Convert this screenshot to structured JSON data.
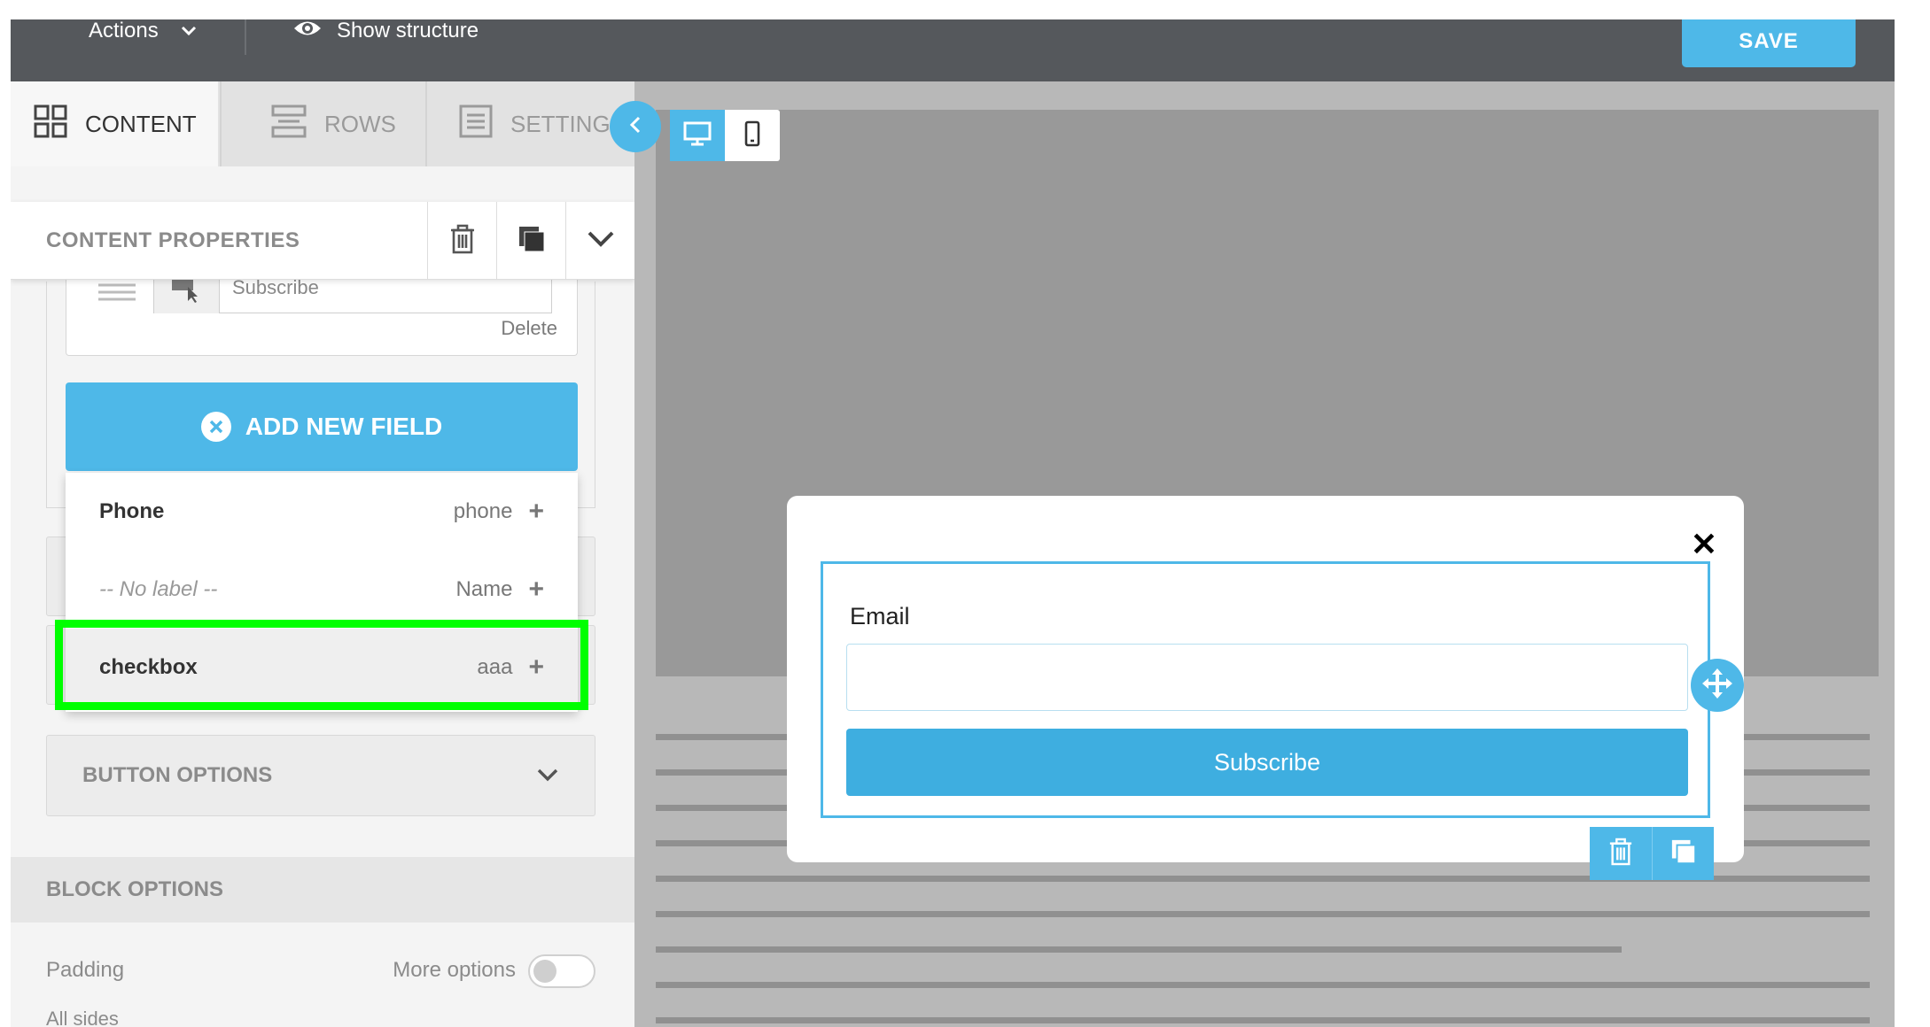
{
  "topbar": {
    "actions_label": "Actions",
    "show_structure_label": "Show structure",
    "save_label": "SAVE"
  },
  "tabs": {
    "content": "CONTENT",
    "rows": "ROWS",
    "settings": "SETTINGS"
  },
  "content_properties": {
    "title": "CONTENT PROPERTIES"
  },
  "field_list": {
    "field_value": "Subscribe",
    "delete_label": "Delete",
    "add_new_field_label": "ADD NEW FIELD"
  },
  "field_dropdown": {
    "items": [
      {
        "label": "Phone",
        "value": "phone"
      },
      {
        "label": "-- No label --",
        "value": "Name"
      },
      {
        "label": "checkbox",
        "value": "aaa"
      }
    ],
    "plus_glyph": "+"
  },
  "button_options": {
    "label": "BUTTON OPTIONS"
  },
  "block_options": {
    "label": "BLOCK OPTIONS",
    "padding_label": "Padding",
    "more_options_label": "More options",
    "all_sides_label": "All sides"
  },
  "popup": {
    "close_glyph": "✕",
    "email_label": "Email",
    "email_value": "",
    "subscribe_label": "Subscribe"
  },
  "colors": {
    "accent": "#4eb8e8",
    "topbar": "#55585c",
    "highlight": "#00ff00"
  }
}
